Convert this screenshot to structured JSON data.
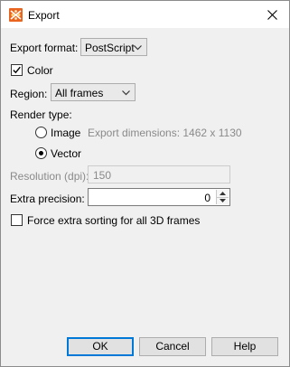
{
  "window": {
    "title": "Export",
    "app_icon": "tecplot-app-icon",
    "close_icon": "close-icon"
  },
  "export_format": {
    "label": "Export format:",
    "value": "PostScript"
  },
  "color": {
    "label": "Color",
    "checked": true
  },
  "region": {
    "label": "Region:",
    "value": "All frames"
  },
  "render_type": {
    "label": "Render type:",
    "image_label": "Image",
    "export_dimensions": "Export dimensions:  1462 x 1130",
    "vector_label": "Vector",
    "selected": "Vector"
  },
  "resolution": {
    "label": "Resolution (dpi):",
    "value": "150"
  },
  "extra_precision": {
    "label": "Extra precision:",
    "value": "0"
  },
  "force_sorting": {
    "label": "Force extra sorting for all 3D frames",
    "checked": false
  },
  "buttons": {
    "ok": "OK",
    "cancel": "Cancel",
    "help": "Help"
  }
}
